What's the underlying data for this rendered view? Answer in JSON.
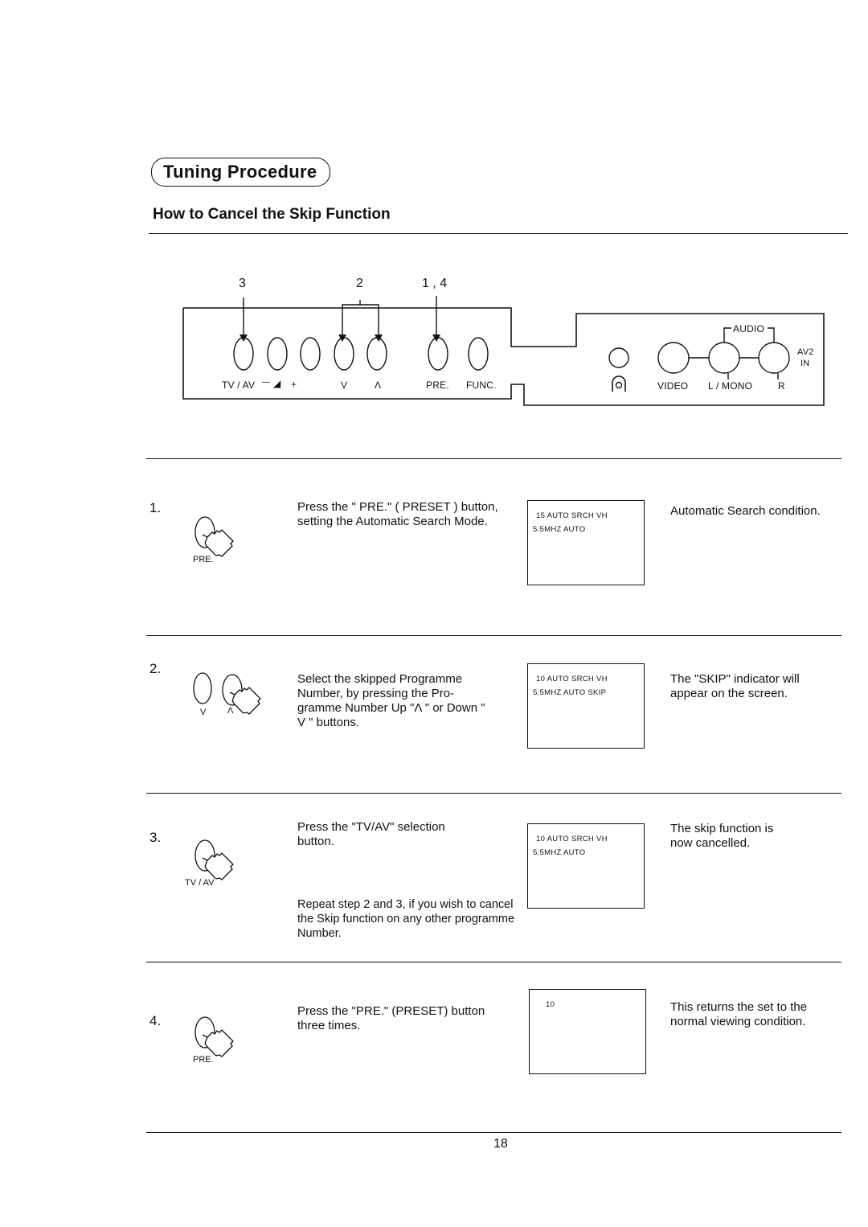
{
  "section": {
    "title": "Tuning Procedure",
    "subtitle": "How to Cancel the Skip Function"
  },
  "panel": {
    "callouts": [
      "3",
      "2",
      "1 , 4"
    ],
    "buttons": [
      {
        "id": "tv-av",
        "label": "TV / AV"
      },
      {
        "id": "vol-minus",
        "label": "—"
      },
      {
        "id": "vol-icon",
        "label": "◢"
      },
      {
        "id": "vol-plus",
        "label": "+"
      },
      {
        "id": "prog-down",
        "label": "V"
      },
      {
        "id": "prog-up",
        "label": "Λ"
      },
      {
        "id": "pre",
        "label": "PRE."
      },
      {
        "id": "func",
        "label": "FUNC."
      }
    ],
    "jacks": {
      "audio_label": "AUDIO",
      "video": "VIDEO",
      "l_mono": "L / MONO",
      "r": "R",
      "av2_line1": "AV2",
      "av2_line2": "IN"
    }
  },
  "steps": [
    {
      "number": "1.",
      "icon_label": "PRE.",
      "text": "Press the \" PRE.\" ( PRESET ) button, setting the Automatic Search Mode.",
      "osd_line1": "15  AUTO  SRCH   VH",
      "osd_line2": "5.5MHZ  AUTO",
      "result": "Automatic Search condition."
    },
    {
      "number": "2.",
      "icon_label_down": "V",
      "icon_label_up": "Λ",
      "text": "Select the skipped Programme Number, by pressing the Pro- gramme Number Up \"Λ \" or Down \" V \" buttons.",
      "osd_line1": "10  AUTO  SRCH   VH",
      "osd_line2": "5.5MHZ  AUTO SKIP",
      "result": "The \"SKIP\" indicator will appear on the screen."
    },
    {
      "number": "3.",
      "icon_label": "TV / AV",
      "text": "Press the \"TV/AV\" selection button.",
      "note": "Repeat step 2 and 3, if you wish to cancel the Skip function on any other programme Number.",
      "osd_line1": "10  AUTO  SRCH   VH",
      "osd_line2": "5.5MHZ  AUTO",
      "result": "The skip function is now cancelled."
    },
    {
      "number": "4.",
      "icon_label": "PRE.",
      "text": "Press the \"PRE.\" (PRESET) button three times.",
      "osd_line1": "10",
      "osd_line2": "",
      "result": "This returns the set to the normal viewing condition."
    }
  ],
  "page_number": "18"
}
